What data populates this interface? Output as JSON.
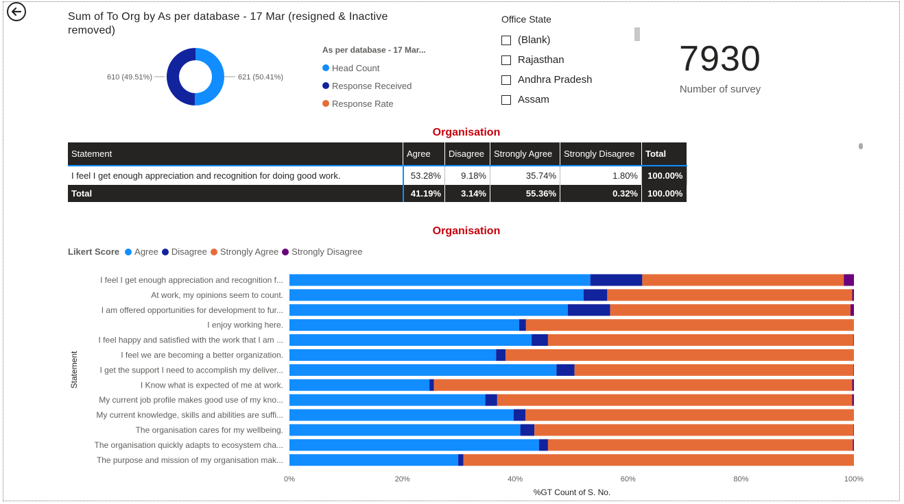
{
  "donut": {
    "title": "Sum of To Org by As per database - 17 Mar (resigned & Inactive removed)",
    "left_label": "610 (49.51%)",
    "right_label": "621 (50.41%)",
    "left_value": 610,
    "right_value": 621,
    "legend_title": "As per database - 17 Mar...",
    "legend": [
      {
        "label": "Head Count",
        "color": "#118dff"
      },
      {
        "label": "Response Received",
        "color": "#12239e"
      },
      {
        "label": "Response Rate",
        "color": "#e66c37"
      }
    ]
  },
  "slicer": {
    "title": "Office State",
    "items": [
      "(Blank)",
      "Rajasthan",
      "Andhra Pradesh",
      "Assam"
    ]
  },
  "card": {
    "value": "7930",
    "label": "Number of survey"
  },
  "table_section": {
    "title": "Organisation",
    "headers": [
      "Statement",
      "Agree",
      "Disagree",
      "Strongly Agree",
      "Strongly Disagree",
      "Total"
    ],
    "row": [
      "I feel I get enough appreciation and recognition for doing good work.",
      "53.28%",
      "9.18%",
      "35.74%",
      "1.80%",
      "100.00%"
    ],
    "total": [
      "Total",
      "41.19%",
      "3.14%",
      "55.36%",
      "0.32%",
      "100.00%"
    ]
  },
  "chart_section": {
    "title": "Organisation",
    "legend_title": "Likert Score",
    "legend": [
      {
        "label": "Agree",
        "color": "#118dff"
      },
      {
        "label": "Disagree",
        "color": "#12239e"
      },
      {
        "label": "Strongly Agree",
        "color": "#e66c37"
      },
      {
        "label": "Strongly Disagree",
        "color": "#6b007b"
      }
    ]
  },
  "chart_data": {
    "type": "bar",
    "orientation": "horizontal",
    "stacked": "100%",
    "xlabel": "%GT Count of S. No.",
    "ylabel": "Statement",
    "xlim": [
      0,
      100
    ],
    "x_ticks": [
      "0%",
      "20%",
      "40%",
      "60%",
      "80%",
      "100%"
    ],
    "categories": [
      "I feel I get enough appreciation and recognition f...",
      "At work, my opinions seem to count.",
      "I am offered opportunities for development to fur...",
      "I enjoy working here.",
      "I feel happy and satisfied with the work that I am ...",
      "I feel we are becoming a better organization.",
      "I get the support I need to accomplish my deliver...",
      "I Know what is expected of me at work.",
      "My current job profile makes good use of my kno...",
      "My current knowledge, skills and abilities are suffi...",
      "The organisation cares for my wellbeing.",
      "The organisation quickly adapts to ecosystem cha...",
      "The purpose and mission of my organisation mak..."
    ],
    "series": [
      {
        "name": "Agree",
        "color": "#118dff",
        "values": [
          53.3,
          52.1,
          49.3,
          40.7,
          42.9,
          36.6,
          47.3,
          24.8,
          34.7,
          39.7,
          40.9,
          44.2,
          29.9
        ]
      },
      {
        "name": "Disagree",
        "color": "#12239e",
        "values": [
          9.2,
          4.2,
          7.5,
          1.2,
          2.9,
          1.7,
          3.2,
          0.8,
          2.1,
          2.1,
          2.5,
          1.6,
          0.9
        ]
      },
      {
        "name": "Strongly Agree",
        "color": "#e66c37",
        "values": [
          35.7,
          43.4,
          42.6,
          58.1,
          54.1,
          61.7,
          49.4,
          74.1,
          62.9,
          58.2,
          56.5,
          54.0,
          69.2
        ]
      },
      {
        "name": "Strongly Disagree",
        "color": "#6b007b",
        "values": [
          1.8,
          0.3,
          0.6,
          0.0,
          0.1,
          0.0,
          0.1,
          0.3,
          0.3,
          0.0,
          0.1,
          0.2,
          0.0
        ]
      }
    ]
  }
}
